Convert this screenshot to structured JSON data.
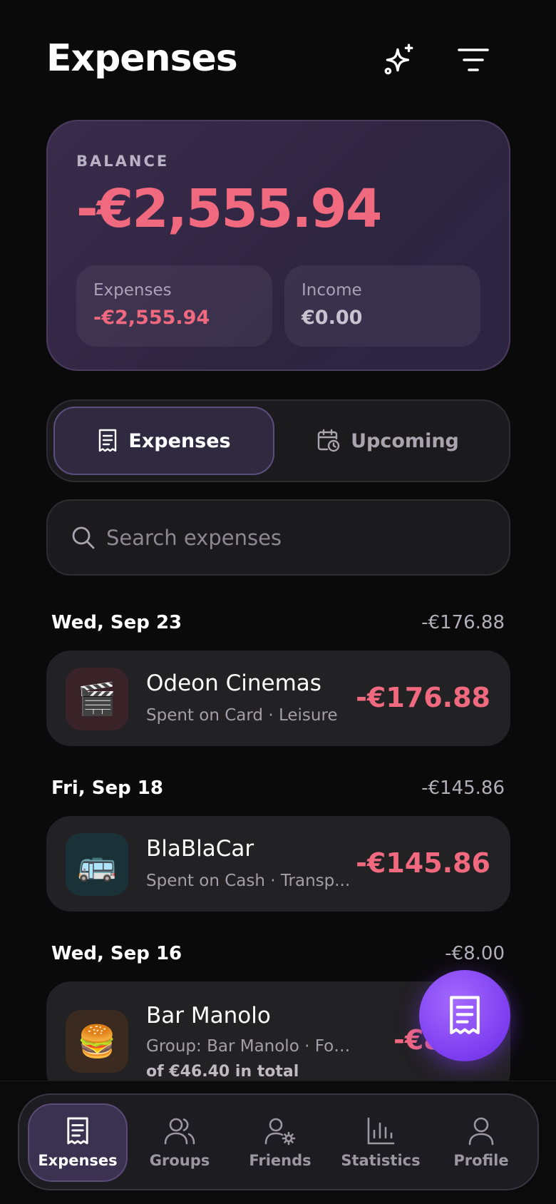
{
  "header": {
    "title": "Expenses",
    "ai_icon": "sparkles-icon",
    "filter_icon": "filter-lines-icon"
  },
  "balance": {
    "label": "BALANCE",
    "value": "-€2,555.94",
    "expenses_label": "Expenses",
    "expenses_value": "-€2,555.94",
    "income_label": "Income",
    "income_value": "€0.00"
  },
  "tabs": [
    {
      "label": "Expenses",
      "icon": "receipt-icon",
      "active": true
    },
    {
      "label": "Upcoming",
      "icon": "calendar-clock-icon",
      "active": false
    }
  ],
  "search": {
    "placeholder": "Search expenses"
  },
  "groups": [
    {
      "date": "Wed, Sep 23",
      "total": "-€176.88",
      "items": [
        {
          "name": "Odeon Cinemas",
          "subtitle": "Spent on Card · Leisure",
          "amount": "-€176.88",
          "icon": "🎬",
          "icon_bg": "#3a2229"
        }
      ]
    },
    {
      "date": "Fri, Sep 18",
      "total": "-€145.86",
      "items": [
        {
          "name": "BlaBlaCar",
          "subtitle": "Spent on Cash · Transp...",
          "amount": "-€145.86",
          "icon": "🚌",
          "icon_bg": "#1b3138"
        }
      ]
    },
    {
      "date": "Wed, Sep 16",
      "total": "-€8.00",
      "items": [
        {
          "name": "Bar Manolo",
          "subtitle": "Group: Bar Manolo · Food",
          "extra": "of €46.40 in total",
          "amount": "-€8.00",
          "icon": "🍔",
          "icon_bg": "#3a2a1f"
        }
      ]
    }
  ],
  "fab": {
    "icon": "receipt-icon"
  },
  "nav": [
    {
      "label": "Expenses",
      "icon": "receipt-icon",
      "active": true
    },
    {
      "label": "Groups",
      "icon": "users-icon",
      "active": false
    },
    {
      "label": "Friends",
      "icon": "user-settings-icon",
      "active": false
    },
    {
      "label": "Statistics",
      "icon": "bar-chart-icon",
      "active": false
    },
    {
      "label": "Profile",
      "icon": "user-icon",
      "active": false
    }
  ],
  "colors": {
    "accent": "#7c3cef",
    "negative": "#f0697f",
    "background": "#0a0a0b"
  }
}
